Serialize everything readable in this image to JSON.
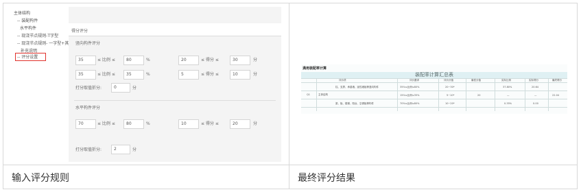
{
  "captions": {
    "left": "输入评分规则",
    "right": "最终评分结果"
  },
  "tree": {
    "items": [
      "主体结构",
      "-- 装配构件",
      "水平构件",
      "-- 现浇节点规则-T字型",
      "-- 现浇节点规则- 一字型+其",
      "补充说明",
      "-- 评分设置"
    ]
  },
  "panel": {
    "header": "得分评分",
    "vertical": {
      "title": "竖向构件评分",
      "row1": {
        "min": "35",
        "op1": "≤ 比例 ≤",
        "max": "80",
        "unit1": "%",
        "score_min": "20",
        "op2": "≤ 得分 ≤",
        "score_max": "30",
        "unit2": "分"
      },
      "row2": {
        "min": "35",
        "op1": "≤ 比例 ≤",
        "max": "35",
        "unit1": "%",
        "score_min": "5",
        "op2": "≤ 得分 ≤",
        "score_max": "10",
        "unit2": "分"
      },
      "interp_label": "打分取值折分:",
      "interp_value": "0",
      "interp_unit": "分"
    },
    "horizontal": {
      "title": "水平构件评分",
      "row1": {
        "min": "70",
        "op1": "≤ 比例 ≤",
        "max": "80",
        "unit1": "%",
        "score_min": "10",
        "op2": "≤ 得分 ≤",
        "score_max": "20",
        "unit2": "分"
      },
      "interp_label": "打分取值折分:",
      "interp_value": "2",
      "interp_unit": "分"
    }
  },
  "result": {
    "section_title": "满用装配率计算",
    "table_title": "装配率计算汇总表",
    "headers": [
      "评价项",
      "评价要求",
      "评价分值",
      "最低分值",
      "实际比例",
      "实际得分",
      "最终得分"
    ],
    "rows": [
      {
        "req": "35%≤比例≤80%",
        "score": "20~30*",
        "ratio": "37.80%",
        "actual": "20.64"
      },
      {
        "req": "15%≤比例≤35%",
        "score": "5~10*",
        "ratio": "—",
        "actual": "—"
      },
      {
        "req": "70%≤比例≤80%",
        "score": "10~20*",
        "ratio": "0.35%",
        "actual": "0.00"
      }
    ],
    "group_num": "Q1",
    "group_name": "主体结构",
    "items": [
      "柱、支撑、承重墙、延性墙板等竖向构件",
      "梁、板、楼梯、阳台、空调板等构件"
    ],
    "min_score": "20",
    "final_score": "22.04"
  }
}
